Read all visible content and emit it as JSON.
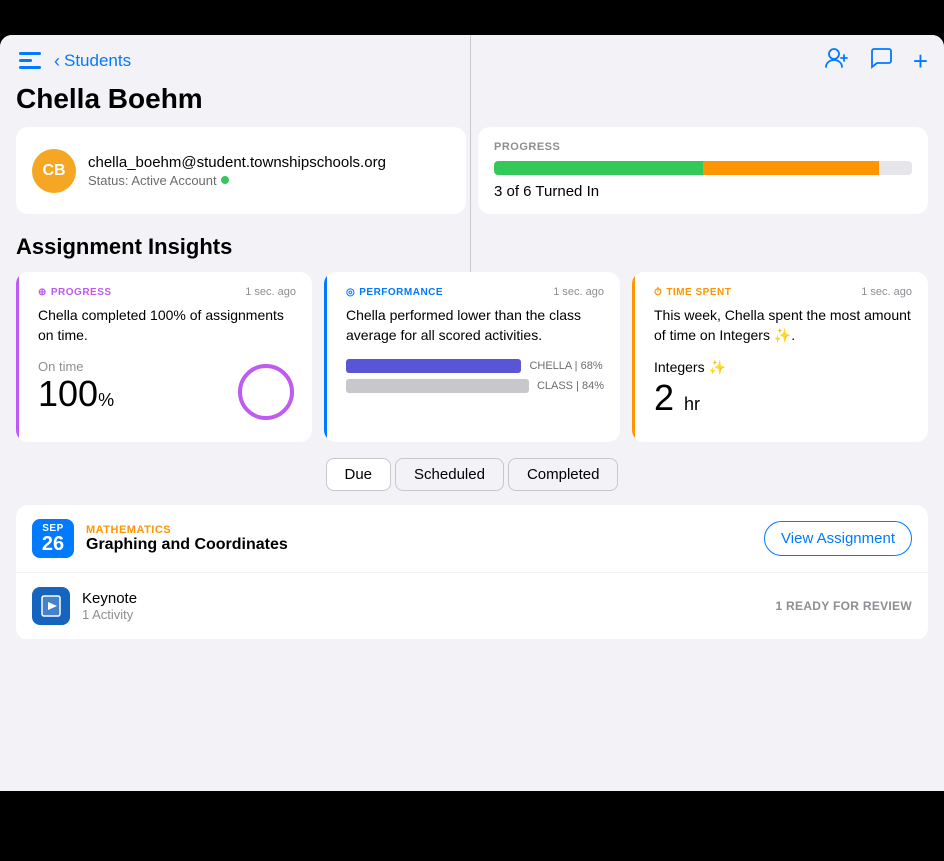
{
  "header": {
    "back_label": "Students",
    "student_name": "Chella Boehm",
    "icons": {
      "add_person": "👤",
      "chat": "💬",
      "plus": "+"
    }
  },
  "profile": {
    "initials": "CB",
    "email": "chella_boehm@student.townshipschools.org",
    "status_label": "Status: Active Account"
  },
  "progress": {
    "label": "PROGRESS",
    "text": "3 of 6 Turned In",
    "green_pct": 50,
    "orange_pct": 42
  },
  "section_title": "Assignment Insights",
  "insights": [
    {
      "badge": "PROGRESS",
      "badge_icon": "↻",
      "timestamp": "1 sec. ago",
      "description": "Chella completed 100% of assignments on time.",
      "stat_label": "On time",
      "stat_value": "100",
      "stat_unit": "%"
    },
    {
      "badge": "PERFORMANCE",
      "badge_icon": "◎",
      "timestamp": "1 sec. ago",
      "description": "Chella performed lower than the class average for all scored activities.",
      "chella_pct": 68,
      "class_pct": 84,
      "chella_label": "CHELLA | 68%",
      "class_label": "CLASS | 84%"
    },
    {
      "badge": "TIME SPENT",
      "badge_icon": "⏱",
      "timestamp": "1 sec. ago",
      "description": "This week, Chella spent the most amount of time on Integers ✨.",
      "topic": "Integers ✨",
      "stat_value": "2",
      "stat_unit": "hr"
    }
  ],
  "filters": [
    "Due",
    "Scheduled",
    "Completed"
  ],
  "active_filter": "Due",
  "assignment": {
    "date_month": "SEP",
    "date_day": "26",
    "subject": "MATHEMATICS",
    "name": "Graphing and Coordinates",
    "view_btn": "View Assignment",
    "items": [
      {
        "icon": "keynote",
        "name": "Keynote",
        "sub": "1 Activity",
        "status": "1 READY FOR REVIEW"
      }
    ]
  }
}
